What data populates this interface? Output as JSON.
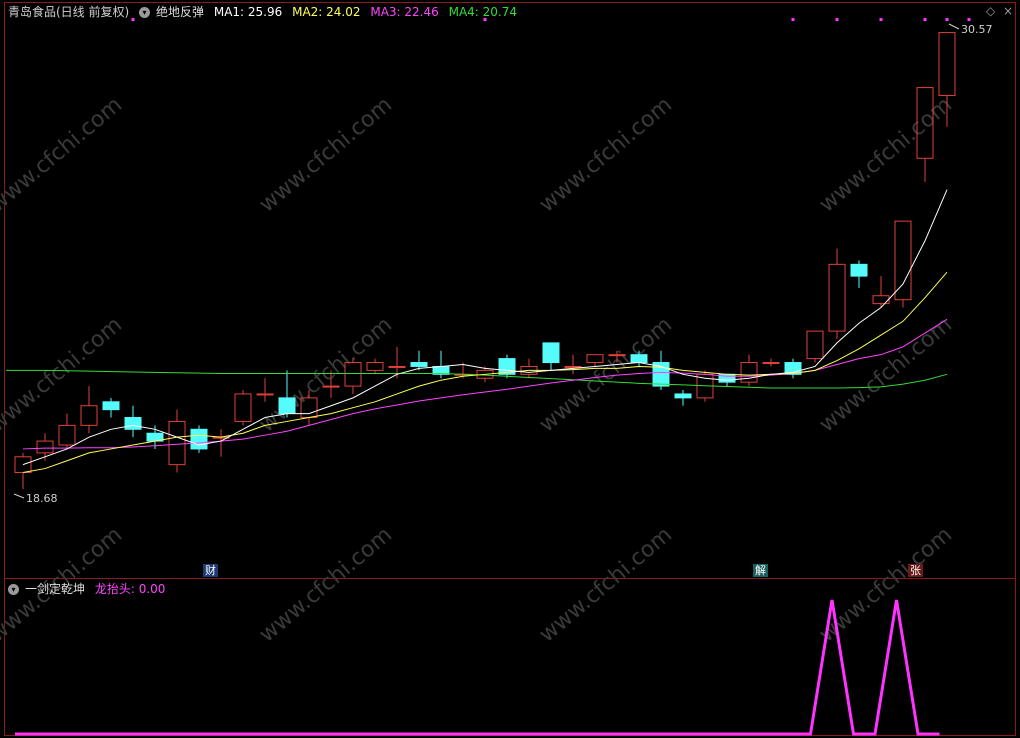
{
  "main": {
    "stock_title": "青岛食品(日线 前复权)",
    "indicator_name": "绝地反弹",
    "ma1_label": "MA1: 25.96",
    "ma2_label": "MA2: 24.02",
    "ma3_label": "MA3: 22.46",
    "ma4_label": "MA4: 20.74",
    "high_label": "30.57",
    "low_label": "18.68",
    "watermark": "www.cfchi.com"
  },
  "sub": {
    "indicator_name": "一剑定乾坤",
    "line_label": "龙抬头: 0.00"
  },
  "event_markers": [
    {
      "label": "财"
    },
    {
      "label": "解"
    },
    {
      "label": "张"
    }
  ],
  "colors": {
    "up": "#e0413a",
    "down": "#54fcfc",
    "ma1": "#ffffff",
    "ma2": "#ffff55",
    "ma3": "#ff44ff",
    "ma4": "#33dd33",
    "signal": "#ff33ff",
    "frame": "#8b1a1a"
  },
  "icons": [
    "dropdown-icon",
    "diamond-icon",
    "close-icon"
  ],
  "chart_data": {
    "type": "candlestick",
    "y_range": [
      18.68,
      30.57
    ],
    "candles": [
      [
        19.1,
        19.5,
        18.68,
        19.6
      ],
      [
        19.6,
        19.9,
        19.4,
        20.1
      ],
      [
        19.8,
        20.3,
        19.7,
        20.6
      ],
      [
        20.3,
        20.8,
        20.1,
        21.3
      ],
      [
        20.9,
        20.7,
        20.5,
        21.0
      ],
      [
        20.5,
        20.2,
        20.0,
        20.8
      ],
      [
        20.1,
        19.9,
        19.7,
        20.3
      ],
      [
        19.3,
        20.4,
        19.1,
        20.7
      ],
      [
        20.2,
        19.7,
        19.6,
        20.3
      ],
      [
        20.0,
        20.0,
        19.5,
        20.2
      ],
      [
        20.4,
        21.1,
        20.3,
        21.2
      ],
      [
        21.1,
        21.1,
        20.9,
        21.5
      ],
      [
        21.0,
        20.6,
        20.5,
        21.7
      ],
      [
        20.5,
        21.0,
        20.3,
        21.2
      ],
      [
        21.3,
        21.3,
        21.0,
        21.7
      ],
      [
        21.3,
        21.9,
        21.1,
        22.0
      ],
      [
        21.7,
        21.9,
        21.6,
        22.0
      ],
      [
        21.8,
        21.8,
        21.5,
        22.3
      ],
      [
        21.9,
        21.8,
        21.7,
        22.2
      ],
      [
        21.8,
        21.6,
        21.5,
        22.2
      ],
      [
        21.6,
        21.6,
        21.5,
        21.9
      ],
      [
        21.5,
        21.7,
        21.4,
        21.8
      ],
      [
        22.0,
        21.6,
        21.5,
        22.1
      ],
      [
        21.6,
        21.8,
        21.5,
        22.0
      ],
      [
        22.4,
        21.9,
        21.7,
        22.4
      ],
      [
        21.8,
        21.8,
        21.6,
        22.1
      ],
      [
        21.9,
        22.1,
        21.8,
        22.1
      ],
      [
        22.1,
        22.1,
        21.9,
        22.2
      ],
      [
        22.1,
        21.9,
        21.8,
        22.2
      ],
      [
        21.9,
        21.3,
        21.2,
        22.2
      ],
      [
        21.1,
        21.0,
        20.8,
        21.2
      ],
      [
        21.0,
        21.6,
        20.9,
        21.7
      ],
      [
        21.6,
        21.4,
        21.3,
        21.6
      ],
      [
        21.4,
        21.9,
        21.3,
        22.1
      ],
      [
        21.9,
        21.9,
        21.8,
        22.0
      ],
      [
        21.9,
        21.6,
        21.5,
        22.0
      ],
      [
        22.0,
        22.7,
        21.9,
        22.7
      ],
      [
        22.7,
        24.4,
        22.5,
        24.8
      ],
      [
        24.4,
        24.1,
        23.8,
        24.5
      ],
      [
        23.4,
        23.6,
        23.3,
        24.1
      ],
      [
        23.5,
        25.5,
        23.3,
        25.5
      ],
      [
        27.1,
        28.9,
        26.5,
        28.9
      ],
      [
        28.7,
        30.3,
        27.9,
        30.3
      ]
    ],
    "ma1": [
      19.3,
      19.5,
      19.7,
      20.0,
      20.2,
      20.3,
      20.2,
      20.0,
      19.8,
      19.9,
      20.2,
      20.5,
      20.6,
      20.6,
      20.8,
      21.0,
      21.3,
      21.6,
      21.75,
      21.8,
      21.85,
      21.75,
      21.7,
      21.65,
      21.7,
      21.75,
      21.8,
      21.85,
      21.9,
      21.8,
      21.6,
      21.5,
      21.45,
      21.5,
      21.6,
      21.65,
      21.8,
      22.4,
      22.9,
      23.3,
      23.9,
      25.0,
      26.3
    ],
    "ma2": [
      19.1,
      19.2,
      19.4,
      19.6,
      19.7,
      19.8,
      19.9,
      20.0,
      20.05,
      20.0,
      20.1,
      20.3,
      20.4,
      20.5,
      20.6,
      20.75,
      20.9,
      21.1,
      21.3,
      21.45,
      21.55,
      21.6,
      21.65,
      21.7,
      21.7,
      21.72,
      21.75,
      21.75,
      21.8,
      21.78,
      21.7,
      21.65,
      21.6,
      21.58,
      21.6,
      21.62,
      21.7,
      21.95,
      22.25,
      22.6,
      22.95,
      23.55,
      24.2
    ],
    "ma3": [
      19.7,
      19.72,
      19.72,
      19.73,
      19.73,
      19.75,
      19.78,
      19.82,
      19.85,
      19.9,
      19.95,
      20.05,
      20.15,
      20.3,
      20.45,
      20.6,
      20.72,
      20.82,
      20.92,
      21.0,
      21.08,
      21.15,
      21.22,
      21.3,
      21.38,
      21.45,
      21.52,
      21.58,
      21.62,
      21.65,
      21.63,
      21.6,
      21.55,
      21.55,
      21.58,
      21.62,
      21.7,
      21.85,
      22.0,
      22.1,
      22.3,
      22.65,
      23.0
    ],
    "ma4": [
      21.7,
      21.7,
      21.69,
      21.68,
      21.67,
      21.66,
      21.65,
      21.64,
      21.63,
      21.62,
      21.62,
      21.62,
      21.62,
      21.62,
      21.62,
      21.62,
      21.62,
      21.62,
      21.62,
      21.62,
      21.6,
      21.58,
      21.55,
      21.52,
      21.49,
      21.46,
      21.43,
      21.4,
      21.37,
      21.35,
      21.33,
      21.31,
      21.29,
      21.27,
      21.25,
      21.25,
      21.25,
      21.25,
      21.26,
      21.28,
      21.35,
      21.45,
      21.6
    ],
    "signal": [
      0,
      0,
      0,
      0,
      0,
      0,
      0,
      0,
      0,
      0,
      0,
      0,
      0,
      0,
      0,
      0,
      0,
      0,
      0,
      0,
      0,
      0,
      0,
      0,
      0,
      0,
      0,
      0,
      0,
      0,
      0,
      0,
      0,
      0,
      0,
      0,
      0,
      0,
      1,
      0,
      0,
      1,
      0,
      0
    ],
    "top_markers": [
      5,
      21,
      35,
      37,
      39,
      41,
      42,
      43
    ]
  }
}
